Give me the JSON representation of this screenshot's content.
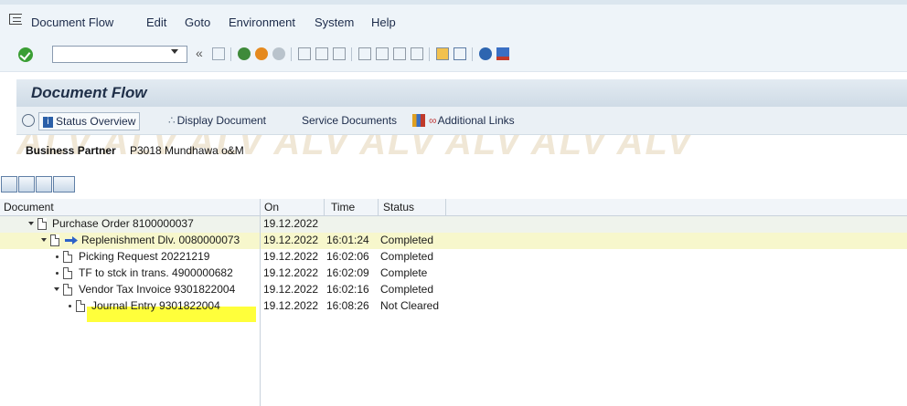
{
  "menu": [
    "Document Flow",
    "Edit",
    "Goto",
    "Environment",
    "System",
    "Help"
  ],
  "toolbar": {
    "command_value": "",
    "back_symbol": "«"
  },
  "page_title": "Document Flow",
  "app_buttons": {
    "status_overview": "Status Overview",
    "display_document": "Display Document",
    "service_documents": "Service Documents",
    "additional_links": "Additional Links"
  },
  "header": {
    "watermark": "ALV ALV ALV ALV ALV ALV ALV ALV",
    "bp_label": "Business Partner",
    "bp_value": "P3018 Mundhawa o&M"
  },
  "columns": {
    "document": "Document",
    "on": "On",
    "time": "Time",
    "status": "Status"
  },
  "rows": [
    {
      "document": "Purchase Order 8100000037",
      "on": "19.12.2022",
      "time": "",
      "status": ""
    },
    {
      "document": "Replenishment Dlv. 0080000073",
      "on": "19.12.2022",
      "time": "16:01:24",
      "status": "Completed"
    },
    {
      "document": "Picking Request 20221219",
      "on": "19.12.2022",
      "time": "16:02:06",
      "status": "Completed"
    },
    {
      "document": "TF to stck in trans. 4900000682",
      "on": "19.12.2022",
      "time": "16:02:09",
      "status": "Complete"
    },
    {
      "document": "Vendor Tax Invoice 9301822004",
      "on": "19.12.2022",
      "time": "16:02:16",
      "status": "Completed"
    },
    {
      "document": "Journal Entry 9301822004",
      "on": "19.12.2022",
      "time": "16:08:26",
      "status": "Not Cleared"
    }
  ],
  "colors": {
    "accent": "#1f2f48",
    "selected_row": "#f7f7cc",
    "highlight": "#ffff3b",
    "ok_green": "#3a9e34"
  }
}
